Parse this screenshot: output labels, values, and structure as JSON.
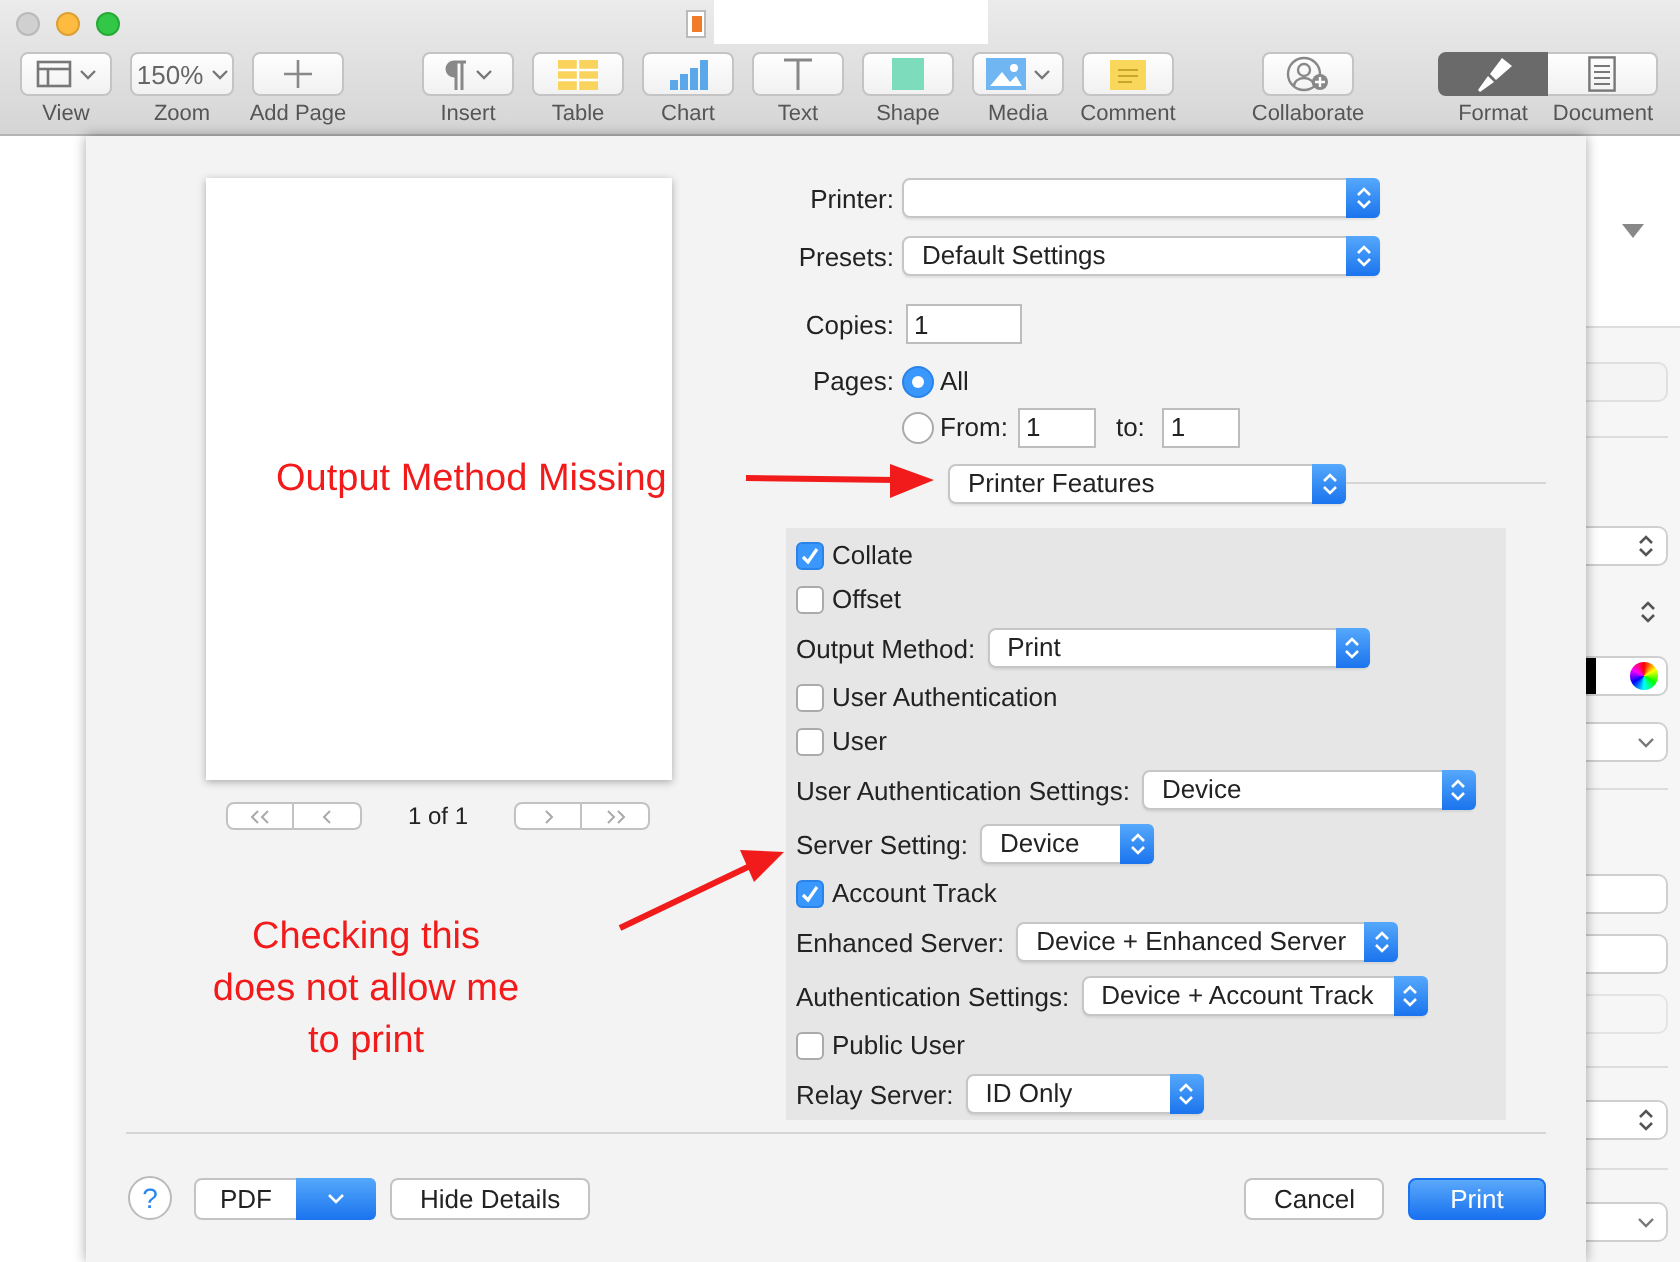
{
  "toolbar": [
    [
      {
        "kind": "view",
        "label": "View",
        "dropdown": true
      },
      {
        "kind": "zoom",
        "label": "Zoom",
        "value": "150%",
        "dropdown": true
      },
      {
        "kind": "add-page",
        "label": "Add Page",
        "dropdown": false
      }
    ],
    [
      {
        "kind": "insert",
        "label": "Insert",
        "dropdown": true
      },
      {
        "kind": "table",
        "label": "Table",
        "dropdown": false
      },
      {
        "kind": "chart",
        "label": "Chart",
        "dropdown": false
      },
      {
        "kind": "text",
        "label": "Text",
        "dropdown": false
      },
      {
        "kind": "shape",
        "label": "Shape",
        "dropdown": false
      },
      {
        "kind": "media",
        "label": "Media",
        "dropdown": true
      },
      {
        "kind": "comment",
        "label": "Comment",
        "dropdown": false
      }
    ],
    [
      {
        "kind": "collaborate",
        "label": "Collaborate",
        "dropdown": false
      }
    ]
  ],
  "view_switch": [
    {
      "kind": "format",
      "label": "Format",
      "selected": true
    },
    {
      "kind": "document",
      "label": "Document",
      "selected": false
    }
  ],
  "print_dialog": {
    "preview": {
      "page_count": "1 of 1"
    },
    "printer": {
      "label": "Printer:"
    },
    "presets": {
      "label": "Presets:",
      "value": "Default Settings"
    },
    "copies": {
      "label": "Copies:",
      "value": "1"
    },
    "pages": {
      "label": "Pages:",
      "options": [
        {
          "label": "All",
          "selected": true
        },
        {
          "label": "From:",
          "selected": false
        }
      ],
      "from": "1",
      "to_label": "to:",
      "to": "1"
    },
    "section": "Printer Features",
    "features": [
      {
        "kind": "checkbox",
        "label": "Collate",
        "checked": true
      },
      {
        "kind": "checkbox",
        "label": "Offset",
        "checked": false
      },
      {
        "kind": "popup",
        "label": "Output Method:",
        "value": "Print"
      },
      {
        "kind": "checkbox",
        "label": "User Authentication",
        "checked": false
      },
      {
        "kind": "checkbox",
        "label": "User",
        "checked": false
      },
      {
        "kind": "popup",
        "label": "User Authentication Settings:",
        "value": "Device"
      },
      {
        "kind": "popup",
        "label": "Server Setting:",
        "value": "Device"
      },
      {
        "kind": "checkbox",
        "label": "Account Track",
        "checked": true
      },
      {
        "kind": "popup",
        "label": "Enhanced Server:",
        "value": "Device + Enhanced Server"
      },
      {
        "kind": "popup",
        "label": "Authentication Settings:",
        "value": "Device + Account Track"
      },
      {
        "kind": "checkbox",
        "label": "Public User",
        "checked": false
      },
      {
        "kind": "popup",
        "label": "Relay Server:",
        "value": "ID Only"
      }
    ],
    "help": "?",
    "pdf": "PDF",
    "hide_details": "Hide Details",
    "cancel": "Cancel",
    "print": "Print"
  },
  "annotations": [
    {
      "text": "Output Method Missing"
    },
    {
      "text": "Checking this does not allow me to print"
    }
  ]
}
